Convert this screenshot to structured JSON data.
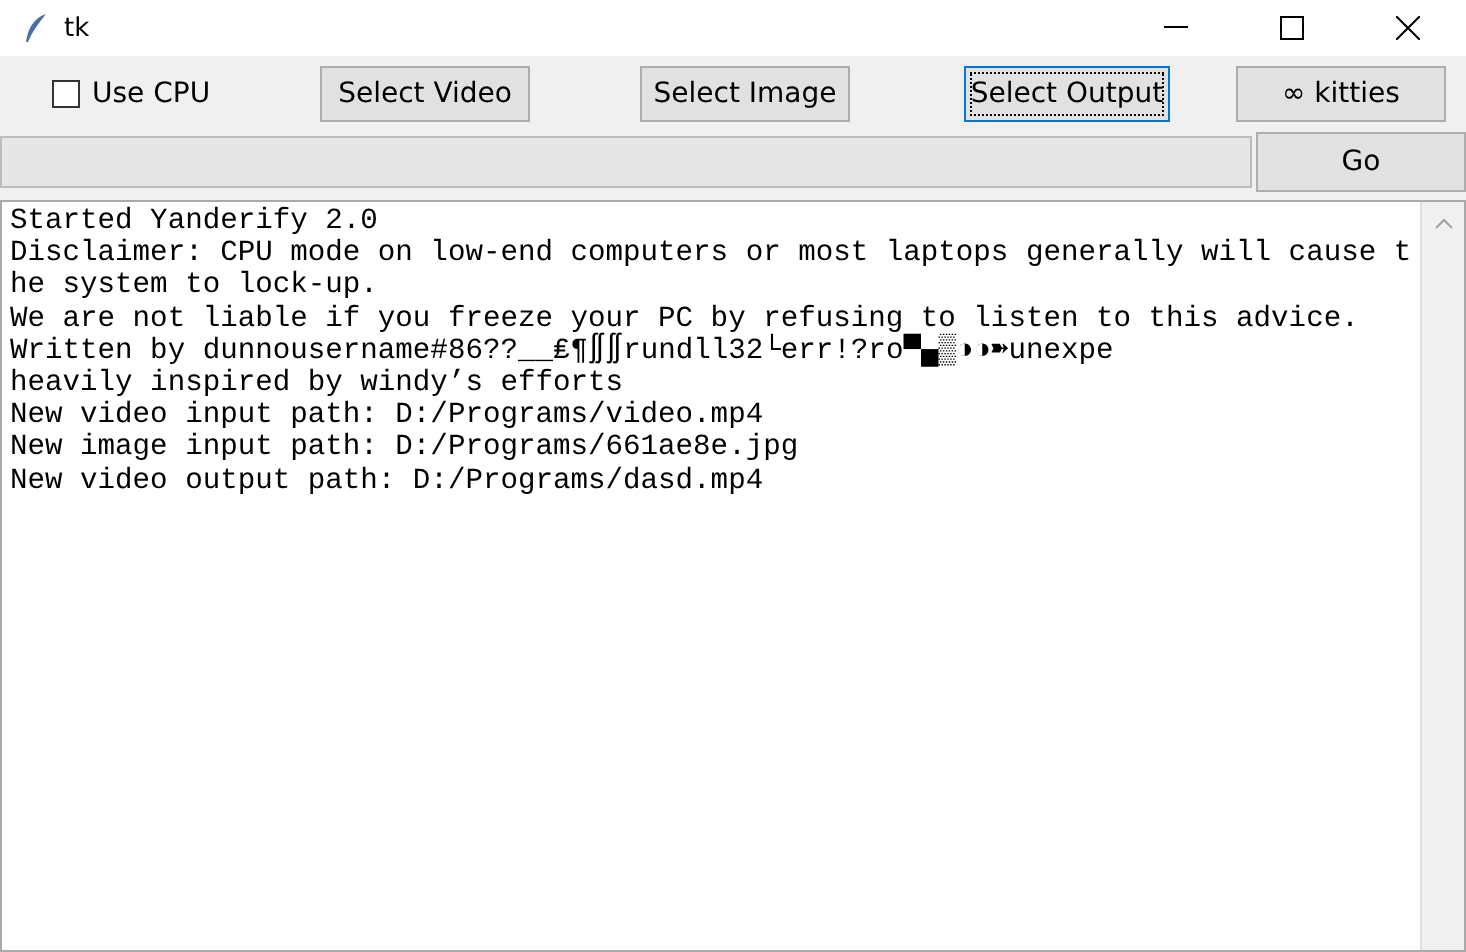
{
  "window": {
    "title": "tk"
  },
  "toolbar": {
    "use_cpu": {
      "label": "Use CPU",
      "checked": false
    },
    "buttons": [
      {
        "label": "Select Video",
        "focused": false
      },
      {
        "label": "Select Image",
        "focused": false
      },
      {
        "label": "Select Output",
        "focused": true
      },
      {
        "label": "∞ kitties",
        "focused": false
      }
    ]
  },
  "go_button": {
    "label": "Go"
  },
  "log": [
    "Started Yanderify 2.0",
    "Disclaimer: CPU mode on low-end computers or most laptops generally will cause t",
    "he system to lock-up.",
    "We are not liable if you freeze your PC by refusing to listen to this advice.",
    "Written by dunnousername#86??__₤¶∬∬rundll32└err!?ro▀▄▒◑◑➽unexpe",
    "heavily inspired by windy’s efforts",
    "New video input path: D:/Programs/video.mp4",
    "New image input path: D:/Programs/661ae8e.jpg",
    "New video output path: D:/Programs/dasd.mp4"
  ]
}
